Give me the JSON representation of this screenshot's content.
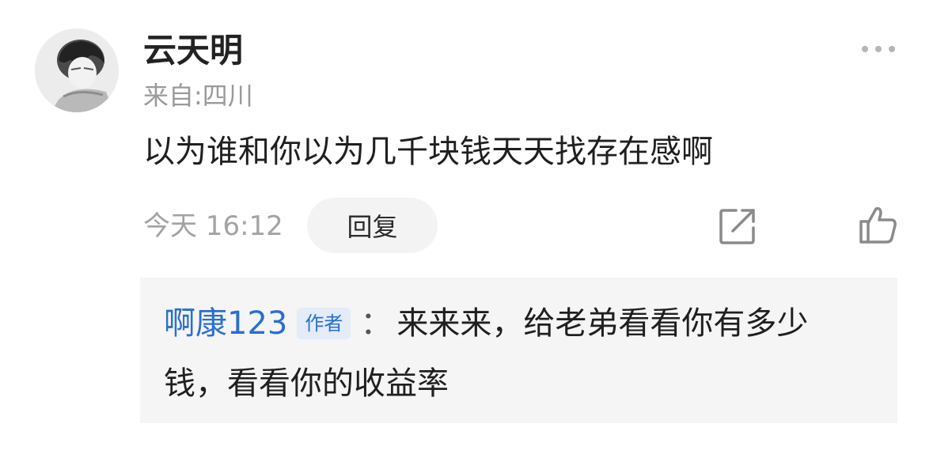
{
  "comment": {
    "user": {
      "name": "云天明",
      "location": "来自:四川",
      "avatar_icon": "avatar-portrait-icon"
    },
    "text": "以为谁和你以为几千块钱天天找存在感啊",
    "timestamp": "今天 16:12",
    "reply_label": "回复",
    "icons": {
      "more": "more-dots-icon",
      "share": "share-external-icon",
      "like": "thumbs-up-icon"
    }
  },
  "reply": {
    "author": "啊康123",
    "badge": "作者",
    "colon": "：",
    "text_line1": "来来来，给老弟看看你有多少",
    "text_line2": "钱，看看你的收益率"
  },
  "colors": {
    "accent": "#2a6fcf",
    "badge_bg": "#e3ecf8",
    "reply_bg": "#f5f5f6"
  }
}
